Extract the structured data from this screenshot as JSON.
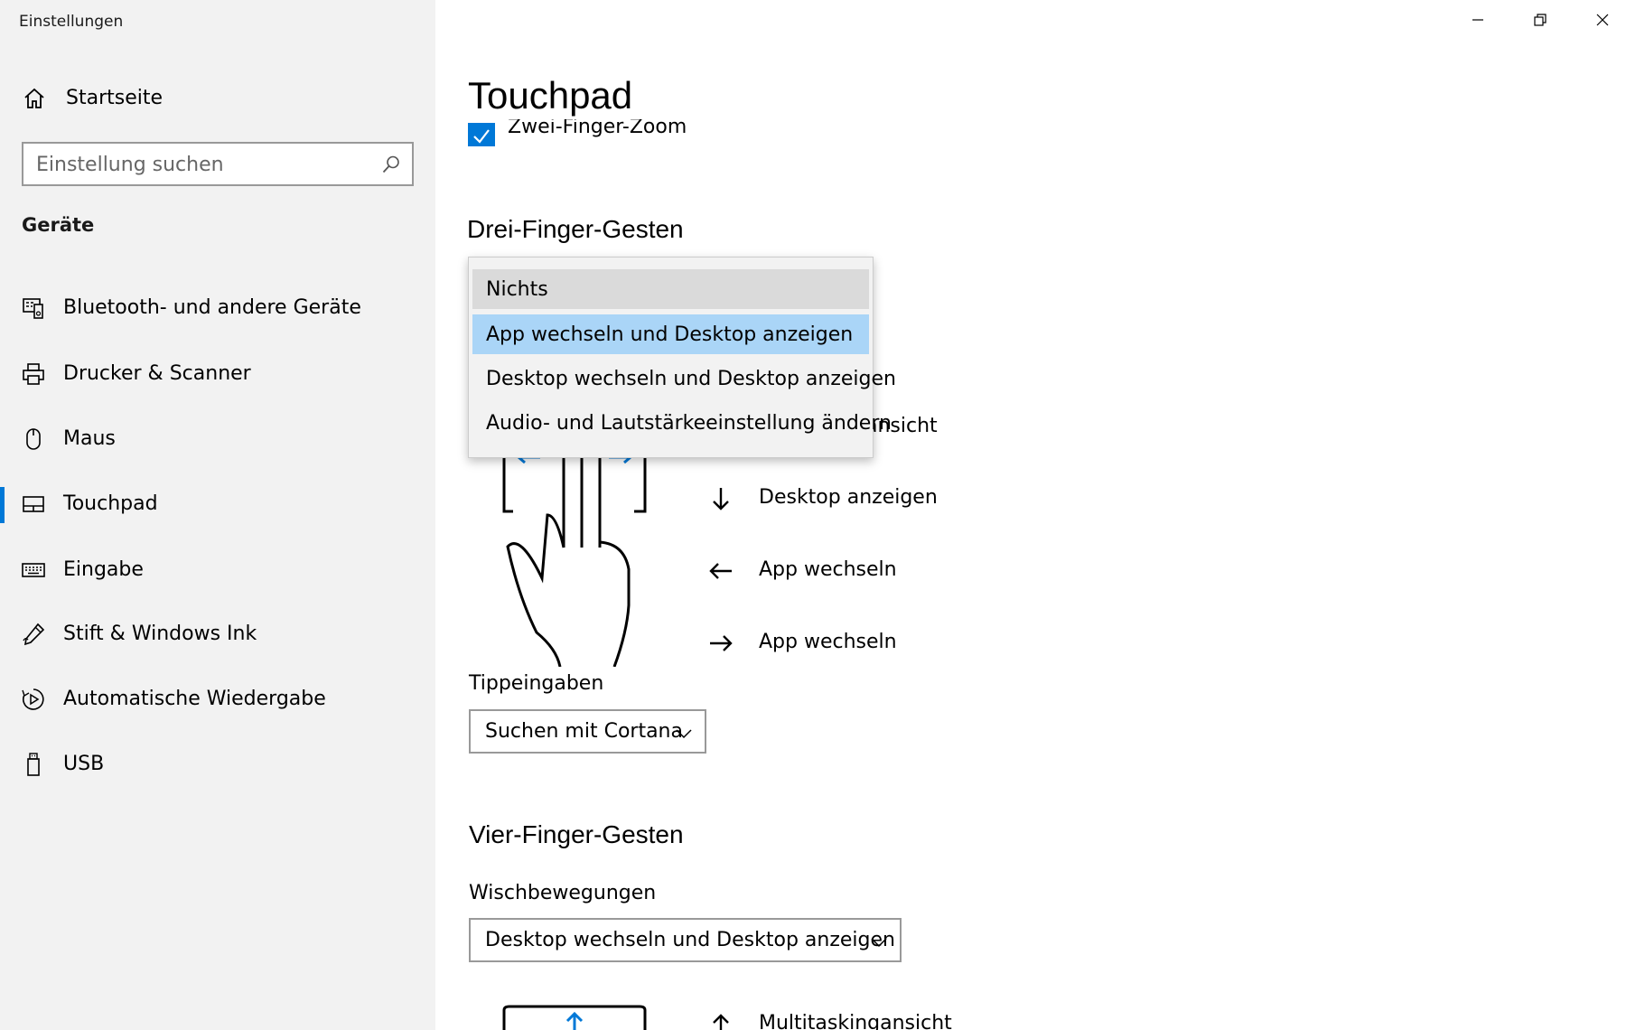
{
  "window": {
    "title": "Einstellungen",
    "controls": [
      "minimize",
      "maximize",
      "close"
    ]
  },
  "sidebar": {
    "home_label": "Startseite",
    "search": {
      "placeholder": "Einstellung suchen",
      "value": ""
    },
    "group_title": "Geräte",
    "items": [
      {
        "label": "Bluetooth- und andere Geräte",
        "icon": "bluetooth-devices-icon",
        "active": false
      },
      {
        "label": "Drucker & Scanner",
        "icon": "printer-icon",
        "active": false
      },
      {
        "label": "Maus",
        "icon": "mouse-icon",
        "active": false
      },
      {
        "label": "Touchpad",
        "icon": "touchpad-icon",
        "active": true
      },
      {
        "label": "Eingabe",
        "icon": "keyboard-icon",
        "active": false
      },
      {
        "label": "Stift & Windows Ink",
        "icon": "pen-icon",
        "active": false
      },
      {
        "label": "Automatische Wiedergabe",
        "icon": "autoplay-icon",
        "active": false
      },
      {
        "label": "USB",
        "icon": "usb-icon",
        "active": false
      }
    ]
  },
  "main": {
    "title": "Touchpad",
    "zoom_checkbox": {
      "label": "Zwei-Finger-Zoom",
      "checked": true
    },
    "three_finger": {
      "title": "Drei-Finger-Gesten",
      "hidden_partial_text": "ansicht",
      "gestures": [
        {
          "arrow": "down-arrow-icon",
          "label": "Desktop anzeigen"
        },
        {
          "arrow": "left-arrow-icon",
          "label": "App wechseln"
        },
        {
          "arrow": "right-arrow-icon",
          "label": "App wechseln"
        }
      ],
      "tap_label": "Tippeingaben",
      "tap_value": "Suchen mit Cortana"
    },
    "four_finger": {
      "title": "Vier-Finger-Gesten",
      "swipe_label": "Wischbewegungen",
      "swipe_value": "Desktop wechseln und Desktop anzeigen",
      "first_gesture": "Multitaskingansicht"
    },
    "dropdown": {
      "options": [
        {
          "label": "Nichts",
          "state": "hover"
        },
        {
          "label": "App wechseln und Desktop anzeigen",
          "state": "selected"
        },
        {
          "label": "Desktop wechseln und Desktop anzeigen",
          "state": "normal"
        },
        {
          "label": "Audio- und Lautstärkeeinstellung ändern",
          "state": "normal"
        }
      ]
    }
  },
  "colors": {
    "accent": "#0078d7",
    "sidebar_bg": "#f2f2f2",
    "selected_option": "#aad5f7",
    "hover_option": "#dadada"
  }
}
